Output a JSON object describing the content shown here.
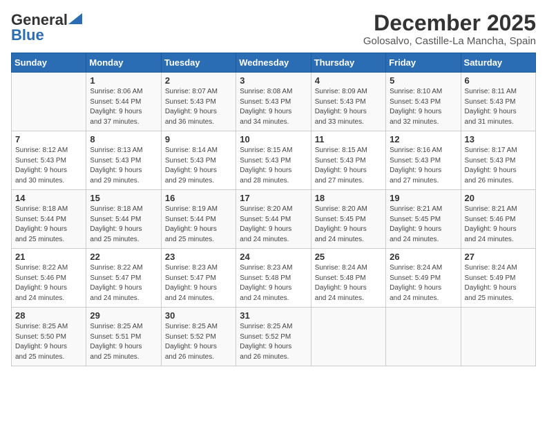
{
  "header": {
    "logo_general": "General",
    "logo_blue": "Blue",
    "month": "December 2025",
    "location": "Golosalvo, Castille-La Mancha, Spain"
  },
  "days_of_week": [
    "Sunday",
    "Monday",
    "Tuesday",
    "Wednesday",
    "Thursday",
    "Friday",
    "Saturday"
  ],
  "weeks": [
    [
      {
        "day": "",
        "info": ""
      },
      {
        "day": "1",
        "info": "Sunrise: 8:06 AM\nSunset: 5:44 PM\nDaylight: 9 hours\nand 37 minutes."
      },
      {
        "day": "2",
        "info": "Sunrise: 8:07 AM\nSunset: 5:43 PM\nDaylight: 9 hours\nand 36 minutes."
      },
      {
        "day": "3",
        "info": "Sunrise: 8:08 AM\nSunset: 5:43 PM\nDaylight: 9 hours\nand 34 minutes."
      },
      {
        "day": "4",
        "info": "Sunrise: 8:09 AM\nSunset: 5:43 PM\nDaylight: 9 hours\nand 33 minutes."
      },
      {
        "day": "5",
        "info": "Sunrise: 8:10 AM\nSunset: 5:43 PM\nDaylight: 9 hours\nand 32 minutes."
      },
      {
        "day": "6",
        "info": "Sunrise: 8:11 AM\nSunset: 5:43 PM\nDaylight: 9 hours\nand 31 minutes."
      }
    ],
    [
      {
        "day": "7",
        "info": "Sunrise: 8:12 AM\nSunset: 5:43 PM\nDaylight: 9 hours\nand 30 minutes."
      },
      {
        "day": "8",
        "info": "Sunrise: 8:13 AM\nSunset: 5:43 PM\nDaylight: 9 hours\nand 29 minutes."
      },
      {
        "day": "9",
        "info": "Sunrise: 8:14 AM\nSunset: 5:43 PM\nDaylight: 9 hours\nand 29 minutes."
      },
      {
        "day": "10",
        "info": "Sunrise: 8:15 AM\nSunset: 5:43 PM\nDaylight: 9 hours\nand 28 minutes."
      },
      {
        "day": "11",
        "info": "Sunrise: 8:15 AM\nSunset: 5:43 PM\nDaylight: 9 hours\nand 27 minutes."
      },
      {
        "day": "12",
        "info": "Sunrise: 8:16 AM\nSunset: 5:43 PM\nDaylight: 9 hours\nand 27 minutes."
      },
      {
        "day": "13",
        "info": "Sunrise: 8:17 AM\nSunset: 5:43 PM\nDaylight: 9 hours\nand 26 minutes."
      }
    ],
    [
      {
        "day": "14",
        "info": "Sunrise: 8:18 AM\nSunset: 5:44 PM\nDaylight: 9 hours\nand 25 minutes."
      },
      {
        "day": "15",
        "info": "Sunrise: 8:18 AM\nSunset: 5:44 PM\nDaylight: 9 hours\nand 25 minutes."
      },
      {
        "day": "16",
        "info": "Sunrise: 8:19 AM\nSunset: 5:44 PM\nDaylight: 9 hours\nand 25 minutes."
      },
      {
        "day": "17",
        "info": "Sunrise: 8:20 AM\nSunset: 5:44 PM\nDaylight: 9 hours\nand 24 minutes."
      },
      {
        "day": "18",
        "info": "Sunrise: 8:20 AM\nSunset: 5:45 PM\nDaylight: 9 hours\nand 24 minutes."
      },
      {
        "day": "19",
        "info": "Sunrise: 8:21 AM\nSunset: 5:45 PM\nDaylight: 9 hours\nand 24 minutes."
      },
      {
        "day": "20",
        "info": "Sunrise: 8:21 AM\nSunset: 5:46 PM\nDaylight: 9 hours\nand 24 minutes."
      }
    ],
    [
      {
        "day": "21",
        "info": "Sunrise: 8:22 AM\nSunset: 5:46 PM\nDaylight: 9 hours\nand 24 minutes."
      },
      {
        "day": "22",
        "info": "Sunrise: 8:22 AM\nSunset: 5:47 PM\nDaylight: 9 hours\nand 24 minutes."
      },
      {
        "day": "23",
        "info": "Sunrise: 8:23 AM\nSunset: 5:47 PM\nDaylight: 9 hours\nand 24 minutes."
      },
      {
        "day": "24",
        "info": "Sunrise: 8:23 AM\nSunset: 5:48 PM\nDaylight: 9 hours\nand 24 minutes."
      },
      {
        "day": "25",
        "info": "Sunrise: 8:24 AM\nSunset: 5:48 PM\nDaylight: 9 hours\nand 24 minutes."
      },
      {
        "day": "26",
        "info": "Sunrise: 8:24 AM\nSunset: 5:49 PM\nDaylight: 9 hours\nand 24 minutes."
      },
      {
        "day": "27",
        "info": "Sunrise: 8:24 AM\nSunset: 5:49 PM\nDaylight: 9 hours\nand 25 minutes."
      }
    ],
    [
      {
        "day": "28",
        "info": "Sunrise: 8:25 AM\nSunset: 5:50 PM\nDaylight: 9 hours\nand 25 minutes."
      },
      {
        "day": "29",
        "info": "Sunrise: 8:25 AM\nSunset: 5:51 PM\nDaylight: 9 hours\nand 25 minutes."
      },
      {
        "day": "30",
        "info": "Sunrise: 8:25 AM\nSunset: 5:52 PM\nDaylight: 9 hours\nand 26 minutes."
      },
      {
        "day": "31",
        "info": "Sunrise: 8:25 AM\nSunset: 5:52 PM\nDaylight: 9 hours\nand 26 minutes."
      },
      {
        "day": "",
        "info": ""
      },
      {
        "day": "",
        "info": ""
      },
      {
        "day": "",
        "info": ""
      }
    ]
  ]
}
